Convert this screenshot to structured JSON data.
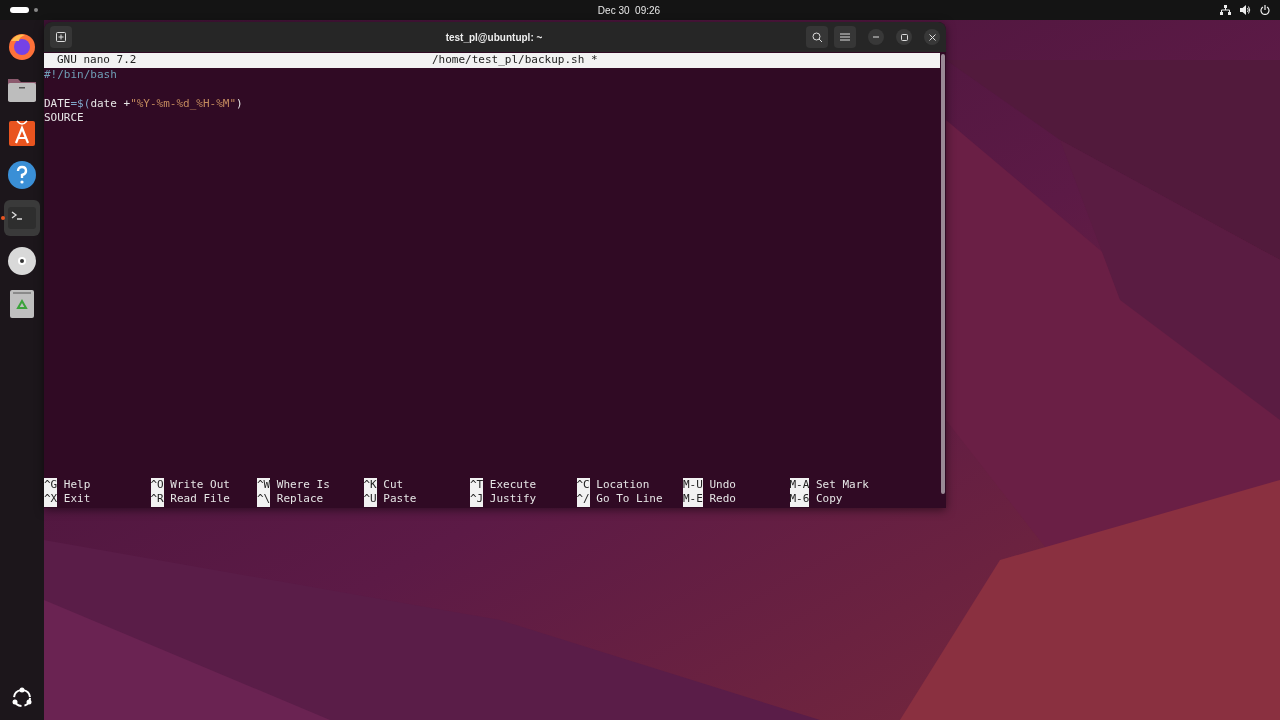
{
  "top_bar": {
    "clock": "Dec 30  09:26"
  },
  "dock": {
    "items": [
      {
        "kind": "firefox",
        "selected": false
      },
      {
        "kind": "files",
        "selected": false
      },
      {
        "kind": "appcenter",
        "selected": false
      },
      {
        "kind": "help",
        "selected": false
      },
      {
        "kind": "terminal",
        "selected": true
      },
      {
        "kind": "disc",
        "selected": false
      },
      {
        "kind": "trash",
        "selected": false
      }
    ]
  },
  "window": {
    "title": "test_pl@ubuntupl: ~"
  },
  "nano": {
    "title": "GNU nano 7.2",
    "file": "/home/test_pl/backup.sh *",
    "lines": [
      {
        "kind": "code",
        "segments": [
          {
            "text": "#!/bin/bash",
            "kind": "comment"
          }
        ]
      },
      {
        "kind": "blank"
      },
      {
        "kind": "code",
        "segments": [
          {
            "text": "DATE",
            "kind": "plain"
          },
          {
            "text": "=$(",
            "kind": "operator"
          },
          {
            "text": "date +",
            "kind": "plain"
          },
          {
            "text": "\"%Y-%m-%d_%H-%M\"",
            "kind": "string"
          },
          {
            "text": ")",
            "kind": "plain"
          }
        ]
      },
      {
        "kind": "code",
        "segments": [
          {
            "text": "SOURCE",
            "kind": "plain"
          }
        ]
      }
    ],
    "shortcut_rows": [
      [
        {
          "key": "^G",
          "label": "Help"
        },
        {
          "key": "^O",
          "label": "Write Out"
        },
        {
          "key": "^W",
          "label": "Where Is"
        },
        {
          "key": "^K",
          "label": "Cut"
        },
        {
          "key": "^T",
          "label": "Execute"
        },
        {
          "key": "^C",
          "label": "Location"
        },
        {
          "key": "M-U",
          "label": "Undo"
        },
        {
          "key": "M-A",
          "label": "Set Mark"
        }
      ],
      [
        {
          "key": "^X",
          "label": "Exit"
        },
        {
          "key": "^R",
          "label": "Read File"
        },
        {
          "key": "^\\",
          "label": "Replace"
        },
        {
          "key": "^U",
          "label": "Paste"
        },
        {
          "key": "^J",
          "label": "Justify"
        },
        {
          "key": "^/",
          "label": "Go To Line"
        },
        {
          "key": "M-E",
          "label": "Redo"
        },
        {
          "key": "M-6",
          "label": "Copy"
        }
      ]
    ]
  }
}
